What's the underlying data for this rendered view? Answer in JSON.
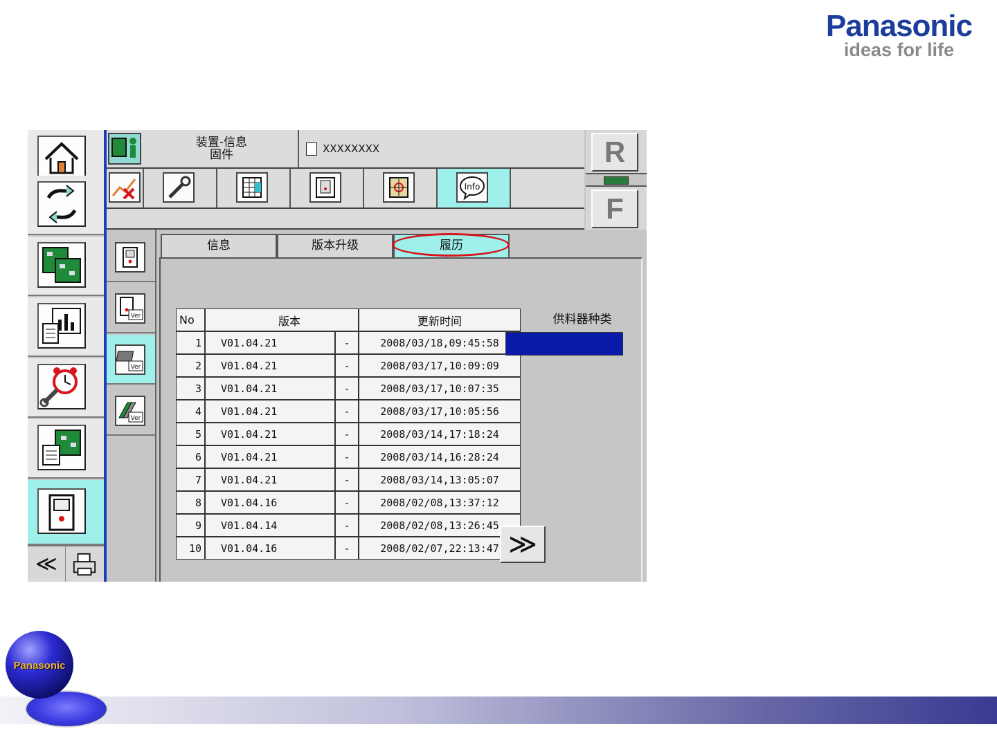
{
  "brand": {
    "name": "Panasonic",
    "tagline": "ideas for life",
    "logo_badge": "Panasonic"
  },
  "header": {
    "title_line1": "装置-信息",
    "title_line2": "固件",
    "document_name": "XXXXXXXX"
  },
  "right_panel": {
    "top_button": "R",
    "bottom_button": "F"
  },
  "tabs": [
    {
      "label": "信息",
      "active": false
    },
    {
      "label": "版本升级",
      "active": false
    },
    {
      "label": "履历",
      "active": true,
      "highlighted": true
    }
  ],
  "history": {
    "columns": {
      "no": "No",
      "version": "版本",
      "updated": "更新时间",
      "feeder": "供料器种类"
    },
    "rows": [
      {
        "no": "1",
        "version": "V01.04.21",
        "flag": "-",
        "updated": "2008/03/18,09:45:58"
      },
      {
        "no": "2",
        "version": "V01.04.21",
        "flag": "-",
        "updated": "2008/03/17,10:09:09"
      },
      {
        "no": "3",
        "version": "V01.04.21",
        "flag": "-",
        "updated": "2008/03/17,10:07:35"
      },
      {
        "no": "4",
        "version": "V01.04.21",
        "flag": "-",
        "updated": "2008/03/17,10:05:56"
      },
      {
        "no": "5",
        "version": "V01.04.21",
        "flag": "-",
        "updated": "2008/03/14,17:18:24"
      },
      {
        "no": "6",
        "version": "V01.04.21",
        "flag": "-",
        "updated": "2008/03/14,16:28:24"
      },
      {
        "no": "7",
        "version": "V01.04.21",
        "flag": "-",
        "updated": "2008/03/14,13:05:07"
      },
      {
        "no": "8",
        "version": "V01.04.16",
        "flag": "-",
        "updated": "2008/02/08,13:37:12"
      },
      {
        "no": "9",
        "version": "V01.04.14",
        "flag": "-",
        "updated": "2008/02/08,13:26:45"
      },
      {
        "no": "10",
        "version": "V01.04.16",
        "flag": "-",
        "updated": "2008/02/07,22:13:47"
      }
    ]
  },
  "buttons": {
    "scroll_down": "≫",
    "page_up": "≪",
    "info": "Info"
  },
  "colors": {
    "active": "#9ff0ea",
    "accent_blue": "#1a3fb8",
    "feeder_bar": "#0a1aa8",
    "highlight_ring": "#d8141c"
  }
}
